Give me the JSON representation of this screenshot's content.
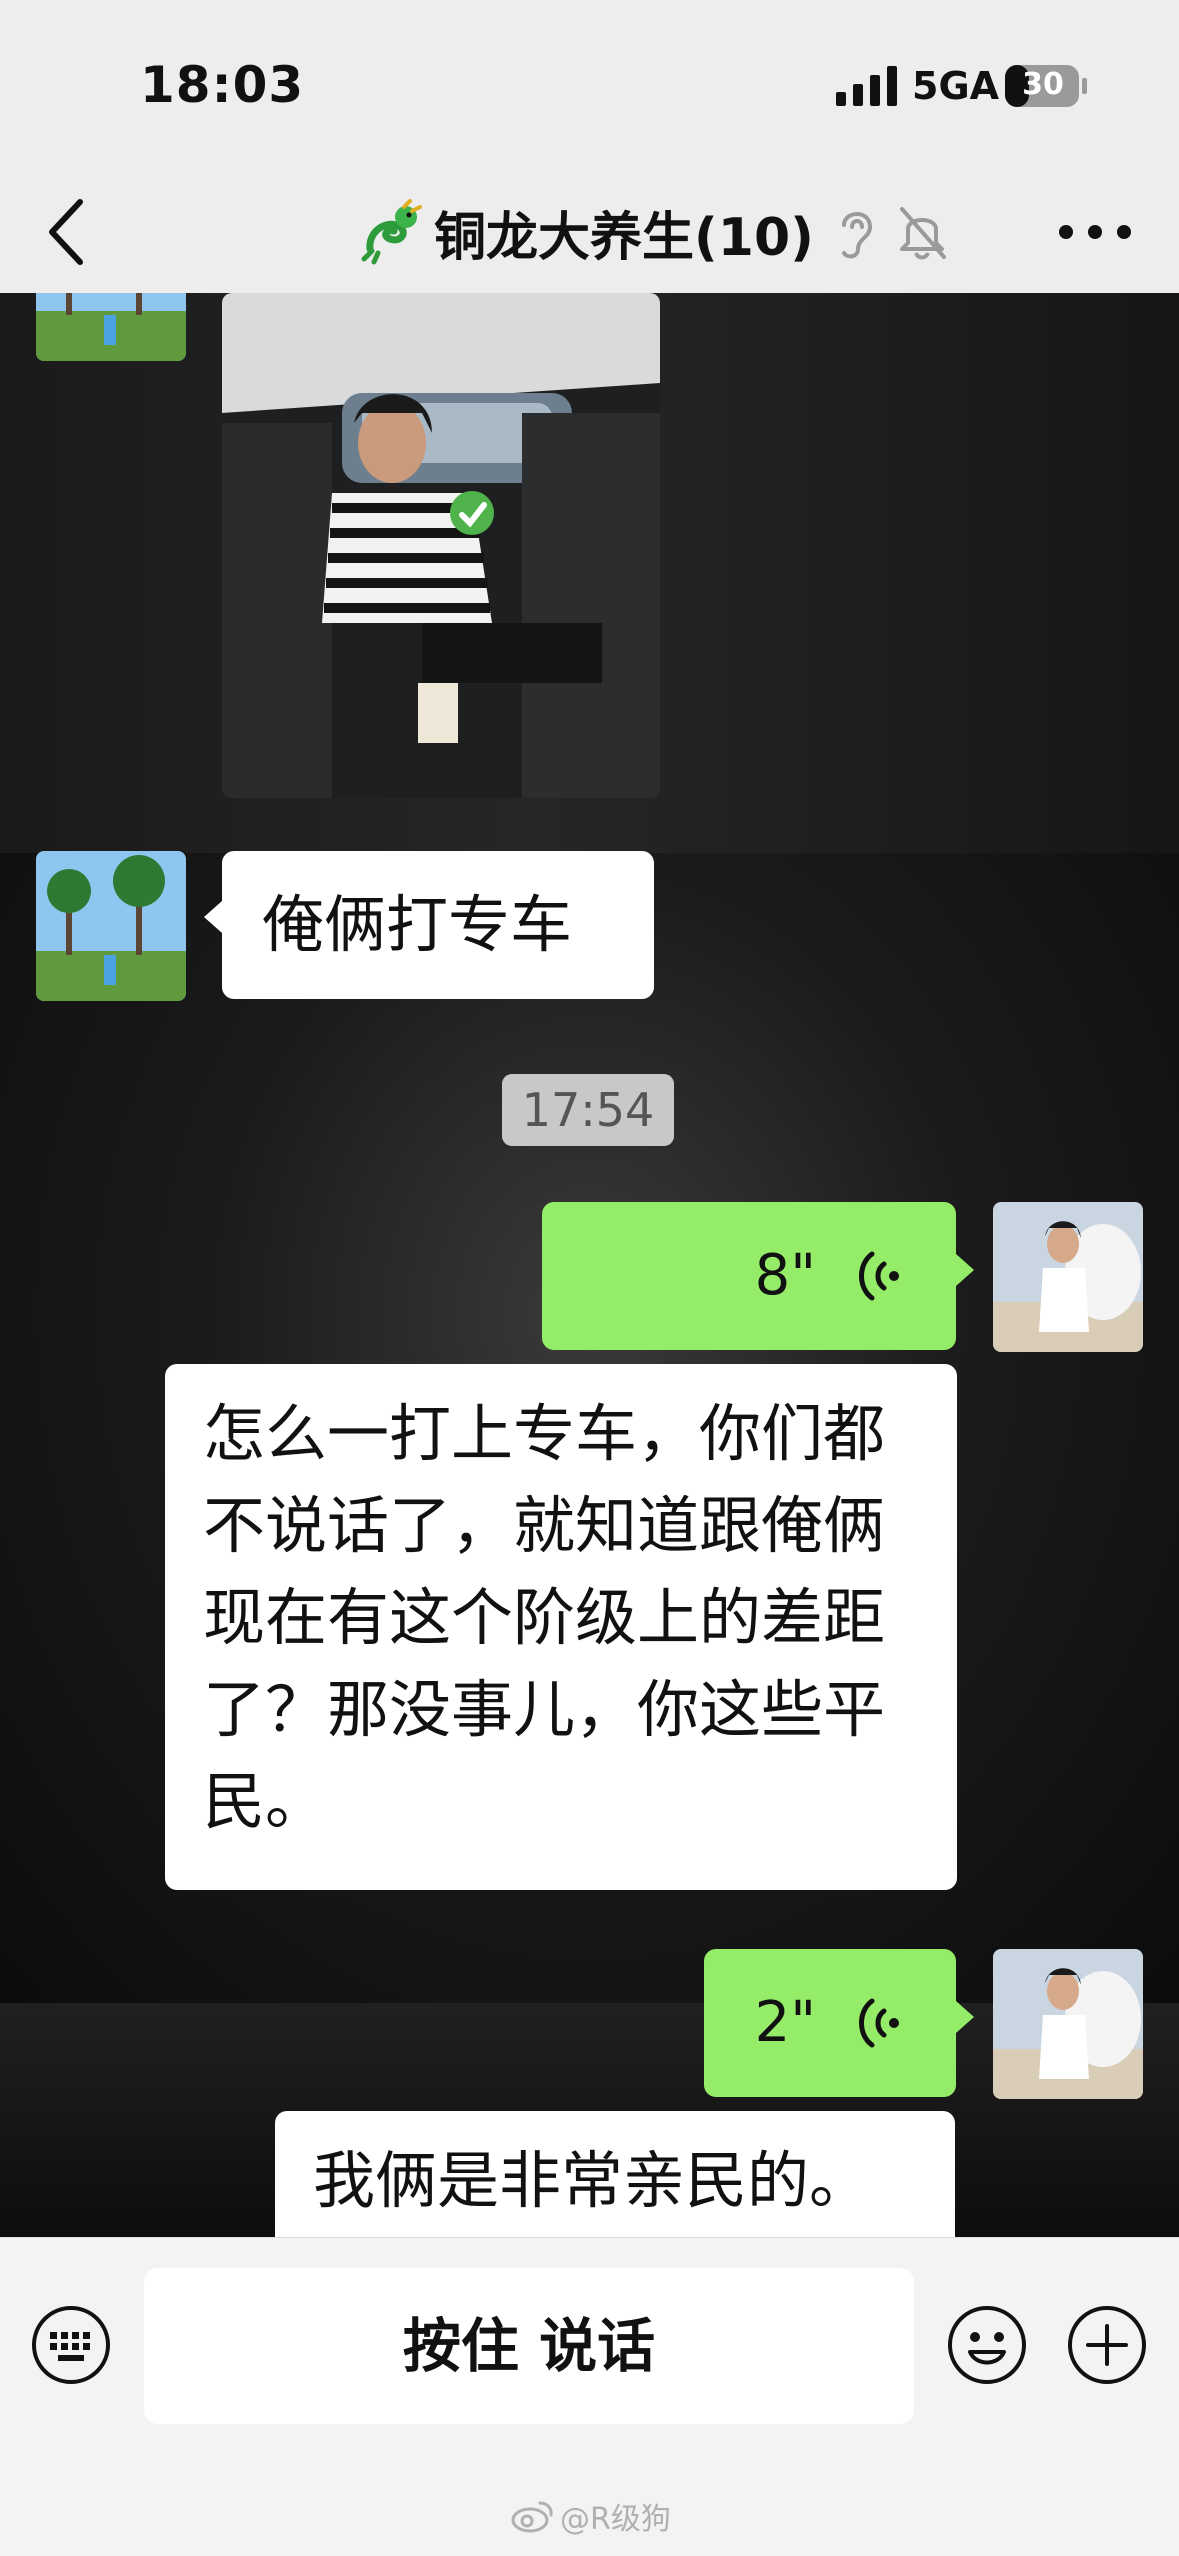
{
  "status_bar": {
    "time": "18:03",
    "network": "5GA",
    "battery": "30",
    "icons": [
      "signal-icon",
      "battery-icon"
    ]
  },
  "nav": {
    "title": "铜龙大养生(10)",
    "icons": [
      "back-chevron-icon",
      "dragon-icon",
      "ear-icon",
      "mute-bell-icon",
      "more-dots-icon"
    ]
  },
  "chat": {
    "messages": [
      {
        "side": "left",
        "type": "image",
        "description_icon": "car-photo"
      },
      {
        "side": "left",
        "type": "text",
        "text": "俺俩打专车"
      },
      {
        "type": "timestamp",
        "text": "17:54"
      },
      {
        "side": "right",
        "type": "voice",
        "duration": "8\""
      },
      {
        "side": "right",
        "type": "text",
        "text": "怎么一打上专车，你们都不说话了，就知道跟俺俩现在有这个阶级上的差距了？那没事儿，你这些平民。"
      },
      {
        "side": "right",
        "type": "voice",
        "duration": "2\""
      },
      {
        "side": "right",
        "type": "text",
        "text": "我俩是非常亲民的。"
      }
    ]
  },
  "input_bar": {
    "hold_to_talk": "按住 说话",
    "icons": [
      "keyboard-icon",
      "emoji-icon",
      "plus-icon"
    ]
  },
  "watermark": {
    "text": "@R级狗",
    "icon": "weibo-icon"
  },
  "colors": {
    "nav_bg": "#ededed",
    "green_bubble": "#95ec69",
    "white_bubble": "#ffffff",
    "timestamp_bg": "#c8c8c8"
  }
}
